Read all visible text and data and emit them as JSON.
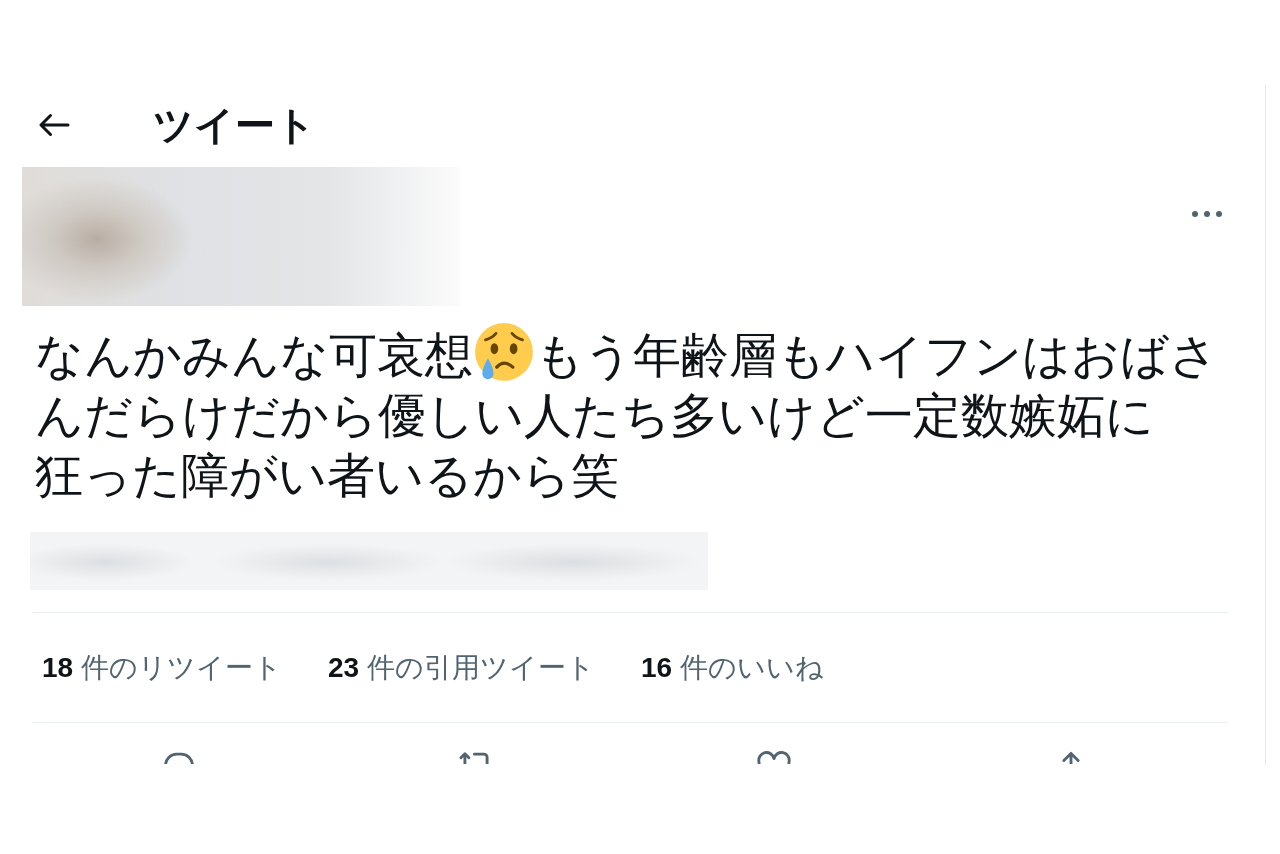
{
  "header": {
    "title": "ツイート"
  },
  "tweet": {
    "body": [
      {
        "kind": "text",
        "text": "なんかみんな可哀想"
      },
      {
        "kind": "emoji"
      },
      {
        "kind": "text",
        "text": "もう年齢層もハイフンはおばさんだらけだから優しい人たち多いけど一定数嫉妬に"
      },
      {
        "kind": "break"
      },
      {
        "kind": "text",
        "text": "狂った障がい者いるから笑"
      }
    ]
  },
  "stats": [
    {
      "count": "18",
      "label": "件のリツイート"
    },
    {
      "count": "23",
      "label": "件の引用ツイート"
    },
    {
      "count": "16",
      "label": "件のいいね"
    }
  ]
}
